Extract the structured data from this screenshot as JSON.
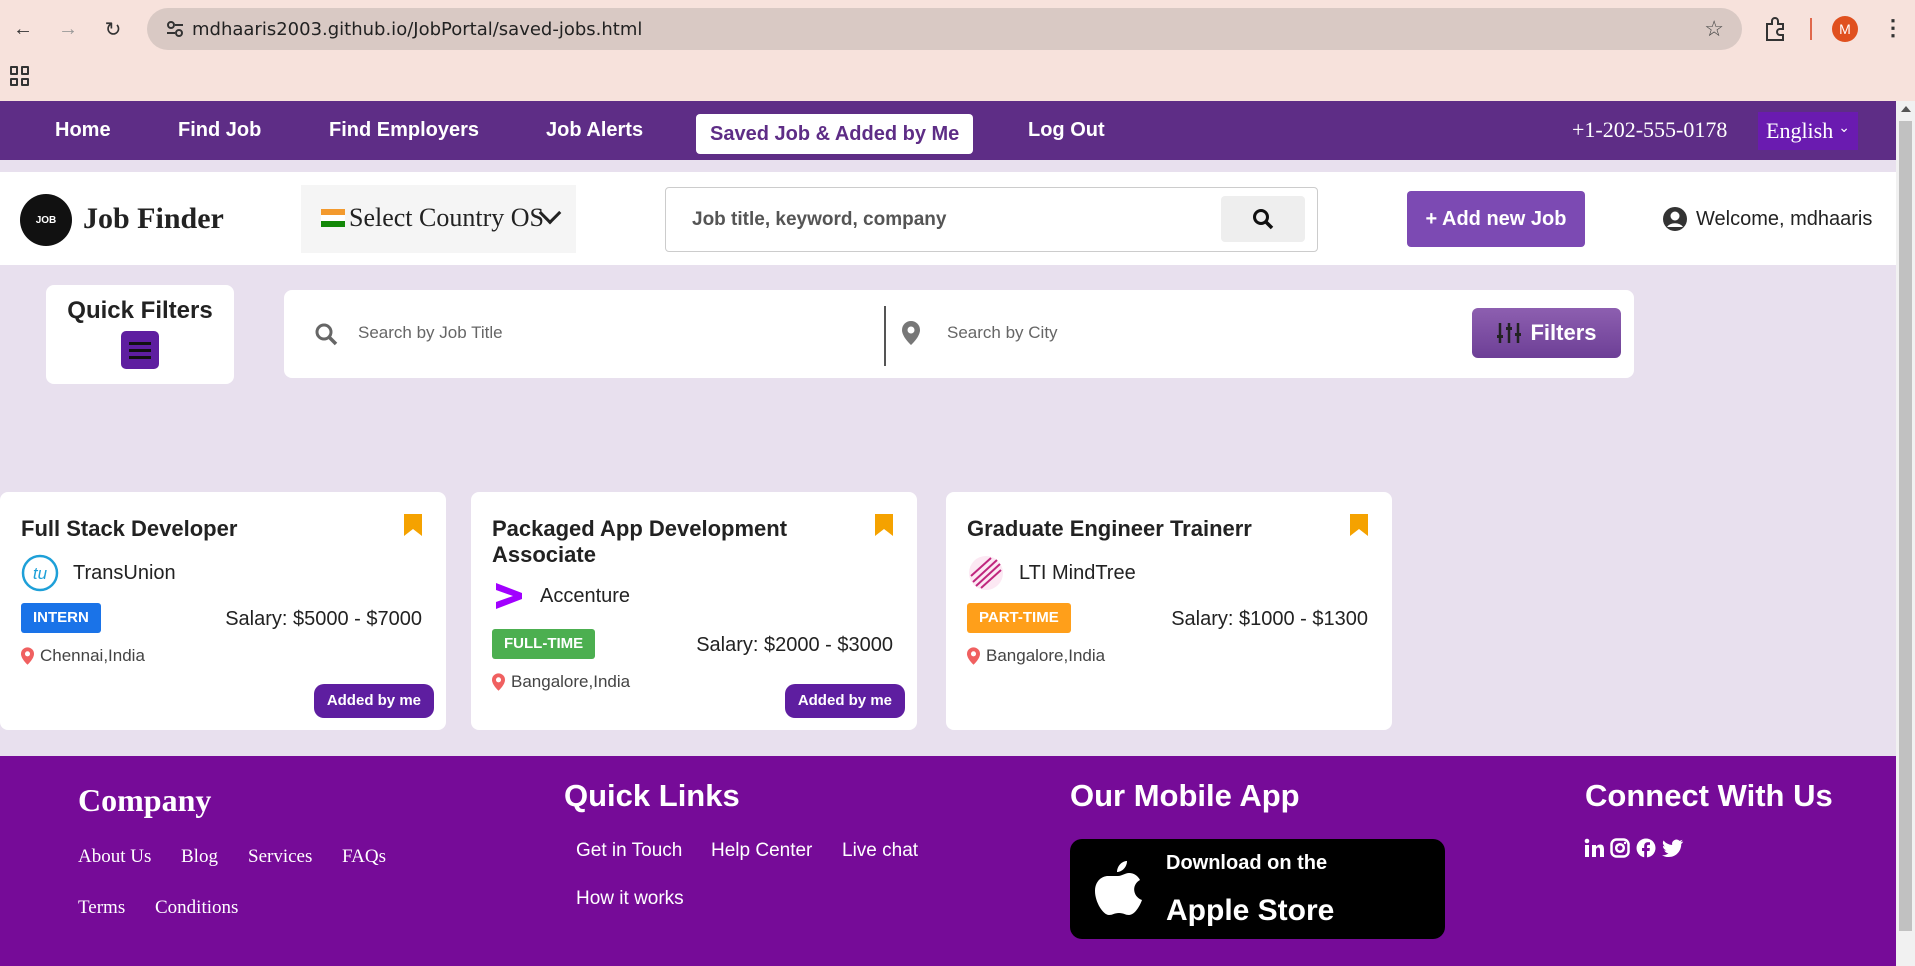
{
  "browser": {
    "url": "mdhaaris2003.github.io/JobPortal/saved-jobs.html",
    "profile_initial": "M"
  },
  "nav": {
    "items": [
      "Home",
      "Find Job",
      "Find Employers",
      "Job Alerts",
      "Saved Job & Added by Me",
      "Log Out"
    ],
    "active": "Saved Job & Added by Me",
    "phone": "+1-202-555-0178",
    "language": "English"
  },
  "header": {
    "brand": "Job Finder",
    "logo_text": "JOB",
    "country_select": "Select Country OS",
    "search_placeholder": "Job title, keyword, company",
    "add_job": "+ Add new Job",
    "welcome": "Welcome, mdhaaris"
  },
  "filters": {
    "quick_filters": "Quick Filters",
    "job_title_placeholder": "Search by Job Title",
    "city_placeholder": "Search by City",
    "filters_button": "Filters"
  },
  "jobs": [
    {
      "title": "Full Stack Developer",
      "company": "TransUnion",
      "type": "INTERN",
      "type_color": "#1a73e8",
      "salary": "Salary: $5000 - $7000",
      "location": "Chennai,India",
      "added": "Added by me"
    },
    {
      "title": "Packaged App Development Associate",
      "company": "Accenture",
      "type": "FULL-TIME",
      "type_color": "#4caf50",
      "salary": "Salary: $2000 - $3000",
      "location": "Bangalore,India",
      "added": "Added by me"
    },
    {
      "title": "Graduate Engineer Trainerr",
      "company": "LTI MindTree",
      "type": "PART-TIME",
      "type_color": "#ff9f1a",
      "salary": "Salary: $1000 - $1300",
      "location": "Bangalore,India"
    }
  ],
  "footer": {
    "company_title": "Company",
    "company_links": [
      "About Us",
      "Blog",
      "Services",
      "FAQs",
      "Terms",
      "Conditions"
    ],
    "quick_links_title": "Quick Links",
    "quick_links": [
      "Get in Touch",
      "Help Center",
      "Live chat",
      "How it works"
    ],
    "app_title": "Our Mobile App",
    "app_line1": "Download on the",
    "app_line2": "Apple Store",
    "connect_title": "Connect With Us"
  }
}
